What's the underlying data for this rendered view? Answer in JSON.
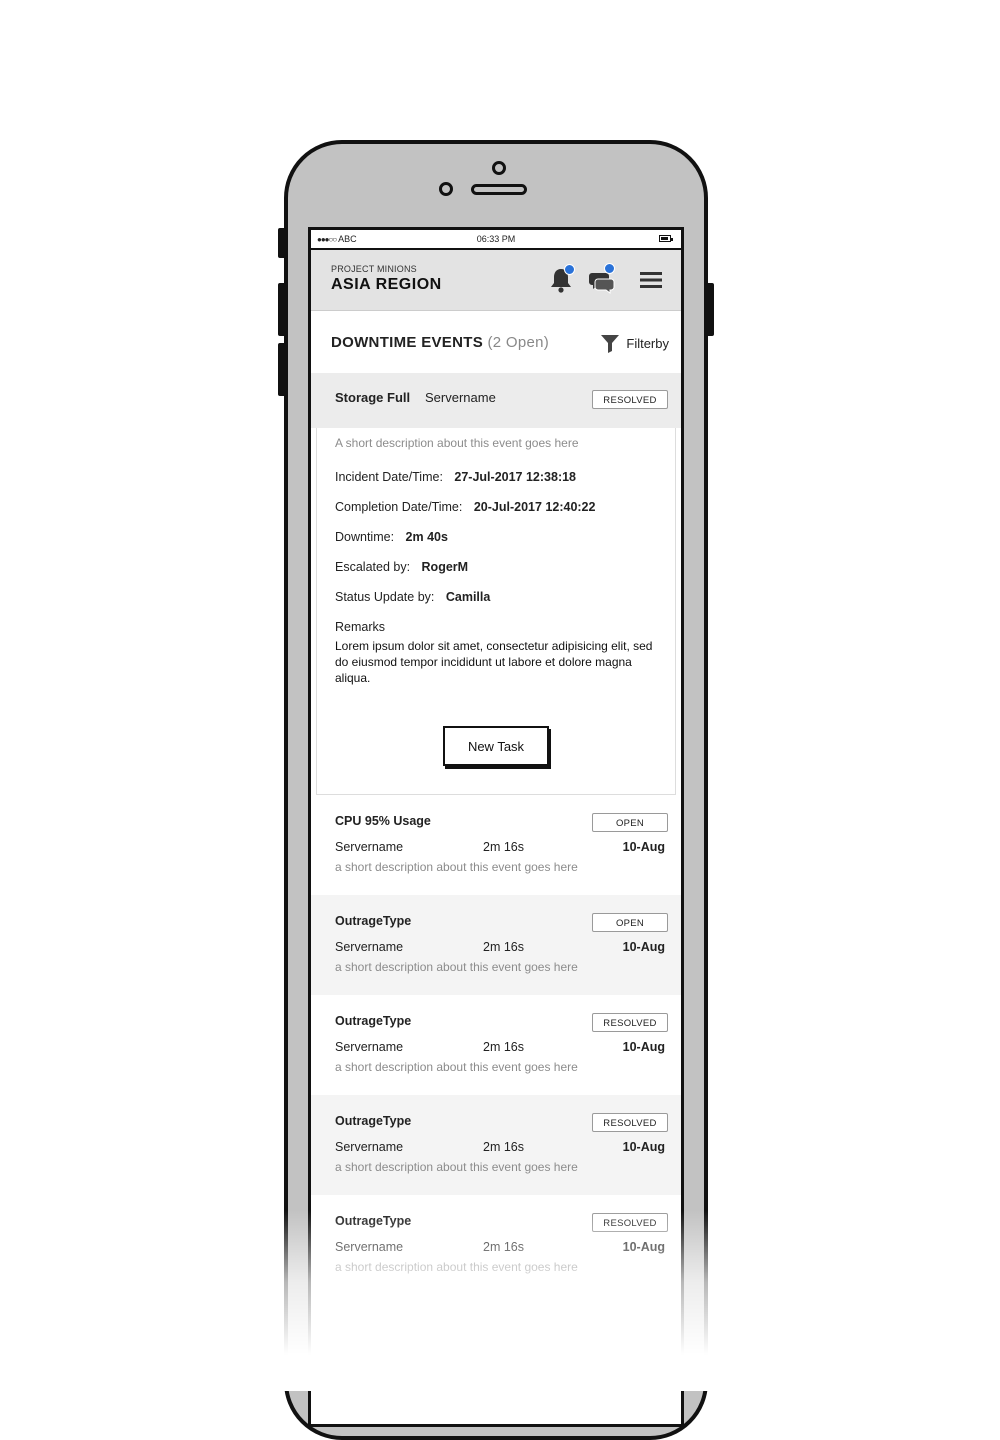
{
  "status_bar": {
    "signal": "●●●○○",
    "carrier": "ABC",
    "time": "06:33 PM"
  },
  "header": {
    "project": "PROJECT MINIONS",
    "region": "ASIA REGION",
    "icons": [
      "bell-icon",
      "chat-icon",
      "hamburger-menu-icon"
    ],
    "badge_color": "#2a72d8"
  },
  "section": {
    "title": "DOWNTIME EVENTS",
    "count": "(2 Open)",
    "filter_label": "Filterby"
  },
  "expanded_event": {
    "type": "Storage Full",
    "server": "Servername",
    "status": "RESOLVED",
    "description": "A short description about this event goes here",
    "incident_label": "Incident Date/Time:",
    "incident_value": "27-Jul-2017 12:38:18",
    "completion_label": "Completion Date/Time:",
    "completion_value": "20-Jul-2017 12:40:22",
    "downtime_label": "Downtime:",
    "downtime_value": "2m 40s",
    "escalated_label": "Escalated by:",
    "escalated_value": "RogerM",
    "status_update_label": "Status Update by:",
    "status_update_value": "Camilla",
    "remarks_label": "Remarks",
    "remarks_text": "Lorem ipsum dolor sit amet, consectetur adipisicing elit, sed do eiusmod tempor incididunt ut labore et dolore magna aliqua.",
    "new_task_label": "New Task"
  },
  "events": [
    {
      "type": "CPU 95% Usage",
      "status": "OPEN",
      "server": "Servername",
      "duration": "2m 16s",
      "date": "10-Aug",
      "description": "a short description about this event goes here"
    },
    {
      "type": "OutrageType",
      "status": "OPEN",
      "server": "Servername",
      "duration": "2m 16s",
      "date": "10-Aug",
      "description": "a short description about this event goes here"
    },
    {
      "type": "OutrageType",
      "status": "RESOLVED",
      "server": "Servername",
      "duration": "2m 16s",
      "date": "10-Aug",
      "description": "a short description about this event goes here"
    },
    {
      "type": "OutrageType",
      "status": "RESOLVED",
      "server": "Servername",
      "duration": "2m 16s",
      "date": "10-Aug",
      "description": "a short description about this event goes here"
    },
    {
      "type": "OutrageType",
      "status": "RESOLVED",
      "server": "Servername",
      "duration": "2m 16s",
      "date": "10-Aug",
      "description": "a short description about this event goes here"
    }
  ]
}
